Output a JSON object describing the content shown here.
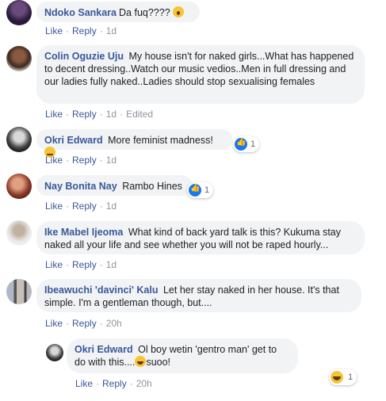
{
  "comments": [
    {
      "name": "Ndoko Sankara",
      "text": "Da fuq???? ",
      "emoji": "wow",
      "like": "Like",
      "reply": "Reply",
      "time": "1d"
    },
    {
      "name": "Colin Oguzie Uju",
      "text": "My house isn't for naked girls...What has happened to decent dressing..Watch our music vedios..Men in full dressing and our ladies fully naked..Ladies should stop sexualising females",
      "like": "Like",
      "reply": "Reply",
      "time": "1d",
      "edited": "Edited"
    },
    {
      "name": "Okri Edward",
      "text": "More feminist madness!",
      "emoji": "smirk",
      "like": "Like",
      "reply": "Reply",
      "time": "1d",
      "reaction_count": "1",
      "reaction_type": "like"
    },
    {
      "name": "Nay Bonita Nay",
      "text": "Rambo Hines",
      "like": "Like",
      "reply": "Reply",
      "time": "1d",
      "reaction_count": "1",
      "reaction_type": "like"
    },
    {
      "name": "Ike Mabel Ijeoma",
      "text": "What kind of back yard talk is this? Kukuma stay naked all your life and see whether you will not be raped hourly...",
      "like": "Like",
      "reply": "Reply",
      "time": "1d"
    },
    {
      "name": "Ibeawuchi 'davinci' Kalu",
      "text": "Let her stay naked in her house. It's that simple. I'm a gentleman though, but....",
      "like": "Like",
      "reply": "Reply",
      "time": "20h"
    },
    {
      "name": "Okri Edward",
      "text_before": "Ol boy wetin 'gentro man' get to do with this....",
      "text_after": "suoo!",
      "emoji": "laugh",
      "like": "Like",
      "reply": "Reply",
      "time": "20h",
      "reaction_count": "1",
      "reaction_type": "haha"
    }
  ],
  "colors": {
    "name": "#385898",
    "bubble": "#f2f3f5",
    "meta": "#90949c",
    "like_reaction": "#1877f2"
  }
}
